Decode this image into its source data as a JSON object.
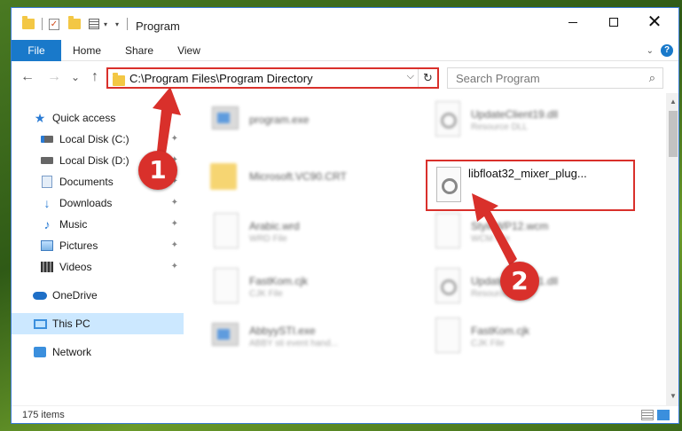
{
  "window": {
    "title": "Program",
    "controls": {
      "minimize": "",
      "maximize": "",
      "close": "✕"
    }
  },
  "ribbon": {
    "tabs": [
      "File",
      "Home",
      "Share",
      "View"
    ],
    "help": "?"
  },
  "nav": {
    "back": "←",
    "forward": "→",
    "recent": "⌄",
    "up": "↑",
    "address": "C:\\Program Files\\Program Directory",
    "dropdown": "⌵",
    "refresh": "↻",
    "search_placeholder": "Search Program",
    "search_icon": "⌕"
  },
  "sidebar": {
    "items": [
      {
        "label": "Quick access",
        "icon": "star-icon",
        "pinned": false
      },
      {
        "label": "Local Disk (C:)",
        "icon": "drive-icon",
        "pinned": true
      },
      {
        "label": "Local Disk (D:)",
        "icon": "drive-icon",
        "pinned": true
      },
      {
        "label": "Documents",
        "icon": "documents-icon",
        "pinned": true
      },
      {
        "label": "Downloads",
        "icon": "downloads-icon",
        "pinned": true
      },
      {
        "label": "Music",
        "icon": "music-icon",
        "pinned": true
      },
      {
        "label": "Pictures",
        "icon": "pictures-icon",
        "pinned": true
      },
      {
        "label": "Videos",
        "icon": "videos-icon",
        "pinned": true
      },
      {
        "label": "OneDrive",
        "icon": "onedrive-icon",
        "pinned": false
      },
      {
        "label": "This PC",
        "icon": "pc-icon",
        "pinned": false,
        "selected": true
      },
      {
        "label": "Network",
        "icon": "network-icon",
        "pinned": false
      }
    ],
    "pin_glyph": "📌"
  },
  "files": [
    {
      "name": "program.exe",
      "type": "",
      "icon": "exe-icon"
    },
    {
      "name": "UpdateClient19.dll",
      "type": "Resource DLL",
      "icon": "dll-icon"
    },
    {
      "name": "Microsoft.VC90.CRT",
      "type": "",
      "icon": "folder-icon"
    },
    {
      "name": "libfloat32_mixer_plug...",
      "type": "",
      "icon": "dll-icon",
      "highlighted": true
    },
    {
      "name": "Arabic.wrd",
      "type": "WRD File",
      "icon": "file-icon"
    },
    {
      "name": "StyleWP12.wcm",
      "type": "WCM File",
      "icon": "file-icon"
    },
    {
      "name": "FastKom.cjk",
      "type": "CJK File",
      "icon": "file-icon"
    },
    {
      "name": "UpdateClient21.dll",
      "type": "Resource DLL",
      "icon": "dll-icon"
    },
    {
      "name": "AbbyySTI.exe",
      "type": "ABBY sti event hand...",
      "icon": "exe-icon"
    },
    {
      "name": "FastKom.cjk",
      "type": "CJK File",
      "icon": "file-icon"
    }
  ],
  "status": {
    "count": "175 items"
  },
  "annotations": {
    "marker1": "1",
    "marker2": "2",
    "color": "#d9302b"
  }
}
